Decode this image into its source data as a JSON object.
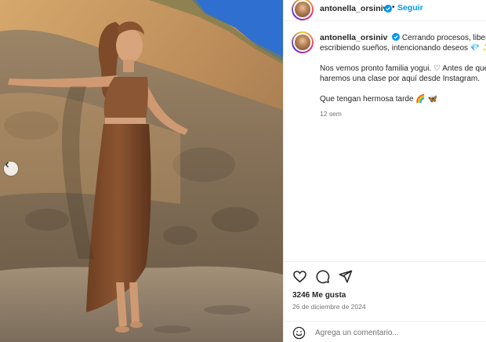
{
  "post": {
    "username": "antonella_orsiniv",
    "follow_label": "Seguir",
    "dot": "•",
    "caption_lines": [
      "Cerrando procesos, liberando",
      "escribiendo sueños, intencionando deseos 💎 ✨",
      "",
      "Nos vemos pronto familia yogui. ♡ Antes de que",
      "haremos una clase por aquí desde Instagram.",
      "",
      "Que tengan hermosa tarde 🌈 🦋"
    ],
    "time_ago": "12 sem",
    "likes": "3246 Me gusta",
    "date": "26 de diciembre de 2024",
    "comment_placeholder": "Agrega un comentario..."
  },
  "icons": {
    "verified": "verified-badge-icon",
    "like": "heart-icon",
    "comment": "comment-bubble-icon",
    "share": "paper-plane-icon",
    "emoji": "smiley-icon",
    "prev": "chevron-left-icon"
  },
  "colors": {
    "link": "#0095f6",
    "text": "#262626",
    "muted": "#737373",
    "border": "#efefef"
  }
}
